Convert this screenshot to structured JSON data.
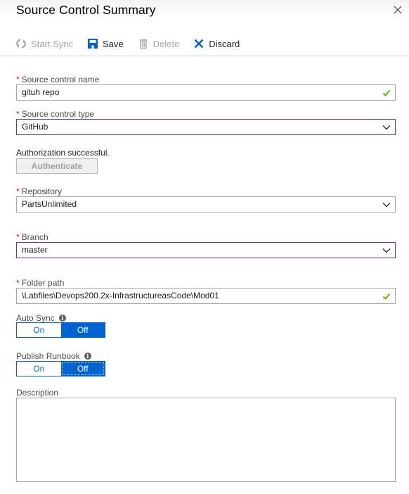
{
  "header": {
    "title": "Source Control Summary",
    "close_icon": "close-icon"
  },
  "toolbar": {
    "start_sync": {
      "label": "Start Sync",
      "icon": "sync-icon",
      "enabled": false
    },
    "save": {
      "label": "Save",
      "icon": "save-icon",
      "enabled": true
    },
    "delete": {
      "label": "Delete",
      "icon": "trash-icon",
      "enabled": false
    },
    "discard": {
      "label": "Discard",
      "icon": "close-icon",
      "enabled": true
    }
  },
  "form": {
    "required_marker": "*",
    "source_control_name": {
      "label": "Source control name",
      "value": "gituh repo",
      "valid": true
    },
    "source_control_type": {
      "label": "Source control type",
      "value": "GitHub"
    },
    "authorization": {
      "status": "Authorization successful.",
      "button_label": "Authenticate"
    },
    "repository": {
      "label": "Repository",
      "value": "PartsUnlimited"
    },
    "branch": {
      "label": "Branch",
      "value": "master"
    },
    "folder_path": {
      "label": "Folder path",
      "value": "\\Labfiles\\Devops200.2x-InfrastructureasCode\\Mod01",
      "valid": true
    },
    "auto_sync": {
      "label": "Auto Sync",
      "info_icon": "i",
      "options": [
        "On",
        "Off"
      ],
      "selected": "Off"
    },
    "publish_runbook": {
      "label": "Publish Runbook",
      "info_icon": "i",
      "options": [
        "On",
        "Off"
      ],
      "selected": "Off"
    },
    "description": {
      "label": "Description",
      "value": ""
    }
  },
  "colors": {
    "accent_blue": "#0063d1",
    "focus_purple": "#7b2d9b",
    "valid_green": "#6bb700",
    "required_red": "#e81123"
  }
}
